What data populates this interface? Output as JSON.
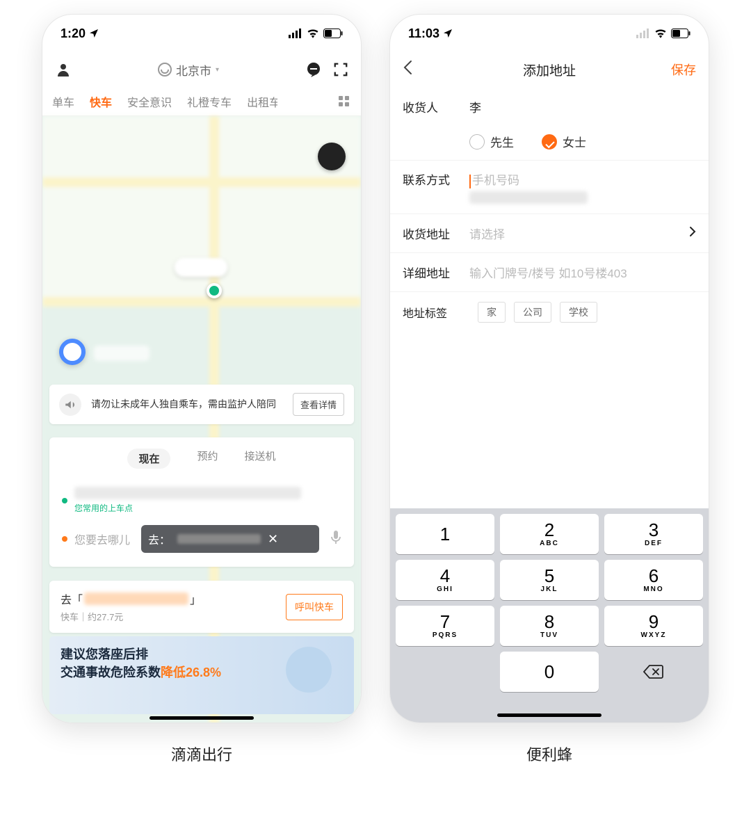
{
  "captions": {
    "left": "滴滴出行",
    "right": "便利蜂"
  },
  "left": {
    "status_time": "1:20",
    "header_city": "北京市",
    "tabs": [
      "单车",
      "快车",
      "安全意识",
      "礼橙专车",
      "出租车"
    ],
    "tab_active_index": 1,
    "notice_text": "请勿让未成年人独自乘车，需由监护人陪同",
    "notice_button": "查看详情",
    "booking_tabs": [
      "现在",
      "预约",
      "接送机"
    ],
    "booking_active_index": 0,
    "pickup_hint": "您常用的上车点",
    "dest_placeholder": "您要去哪儿",
    "dest_suggest_prefix": "去：",
    "call_prefix": "去「",
    "call_suffix": "」",
    "call_sub": "快车｜约27.7元",
    "call_button": "呼叫快车",
    "banner_line1": "建议您落座后排",
    "banner_line2_a": "交通事故危险系数",
    "banner_line2_b": "降低26.8%"
  },
  "right": {
    "status_time": "11:03",
    "nav_title": "添加地址",
    "nav_save": "保存",
    "recipient_label": "收货人",
    "recipient_value": "李",
    "gender_options": [
      "先生",
      "女士"
    ],
    "gender_selected_index": 1,
    "contact_label": "联系方式",
    "contact_placeholder": "手机号码",
    "address_label": "收货地址",
    "address_placeholder": "请选择",
    "detail_label": "详细地址",
    "detail_placeholder": "输入门牌号/楼号 如10号楼403",
    "tag_label": "地址标签",
    "tags": [
      "家",
      "公司",
      "学校"
    ],
    "keypad": [
      {
        "num": "1",
        "let": ""
      },
      {
        "num": "2",
        "let": "ABC"
      },
      {
        "num": "3",
        "let": "DEF"
      },
      {
        "num": "4",
        "let": "GHI"
      },
      {
        "num": "5",
        "let": "JKL"
      },
      {
        "num": "6",
        "let": "MNO"
      },
      {
        "num": "7",
        "let": "PQRS"
      },
      {
        "num": "8",
        "let": "TUV"
      },
      {
        "num": "9",
        "let": "WXYZ"
      }
    ],
    "keypad_zero": "0"
  }
}
